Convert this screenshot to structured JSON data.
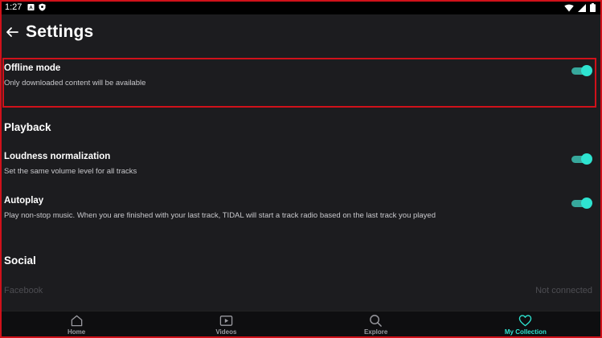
{
  "status_bar": {
    "time": "1:27",
    "left_icons": [
      "letter-a-icon",
      "shield-icon"
    ],
    "right_icons": [
      "wifi-icon",
      "signal-icon",
      "battery-icon"
    ]
  },
  "header": {
    "back_icon": "arrow-left-icon",
    "title": "Settings"
  },
  "offline_mode": {
    "title": "Offline mode",
    "subtitle": "Only downloaded content will be available",
    "enabled": true
  },
  "playback": {
    "section_title": "Playback",
    "items": [
      {
        "title": "Loudness normalization",
        "subtitle": "Set the same volume level for all tracks",
        "enabled": true
      },
      {
        "title": "Autoplay",
        "subtitle": "Play non-stop music. When you are finished with your last track, TIDAL will start a track radio based on the last track you played",
        "enabled": true
      }
    ]
  },
  "social": {
    "section_title": "Social",
    "facebook_label": "Facebook",
    "facebook_status": "Not connected"
  },
  "bottom_nav": {
    "items": [
      {
        "label": "Home",
        "icon": "home-icon",
        "active": false
      },
      {
        "label": "Videos",
        "icon": "video-icon",
        "active": false
      },
      {
        "label": "Explore",
        "icon": "search-icon",
        "active": false
      },
      {
        "label": "My Collection",
        "icon": "heart-icon",
        "active": true
      }
    ]
  },
  "colors": {
    "accent": "#2ee3d0",
    "toggle_track": "#37a89c",
    "highlight_border": "#d0111a",
    "background": "#1c1c1f"
  }
}
